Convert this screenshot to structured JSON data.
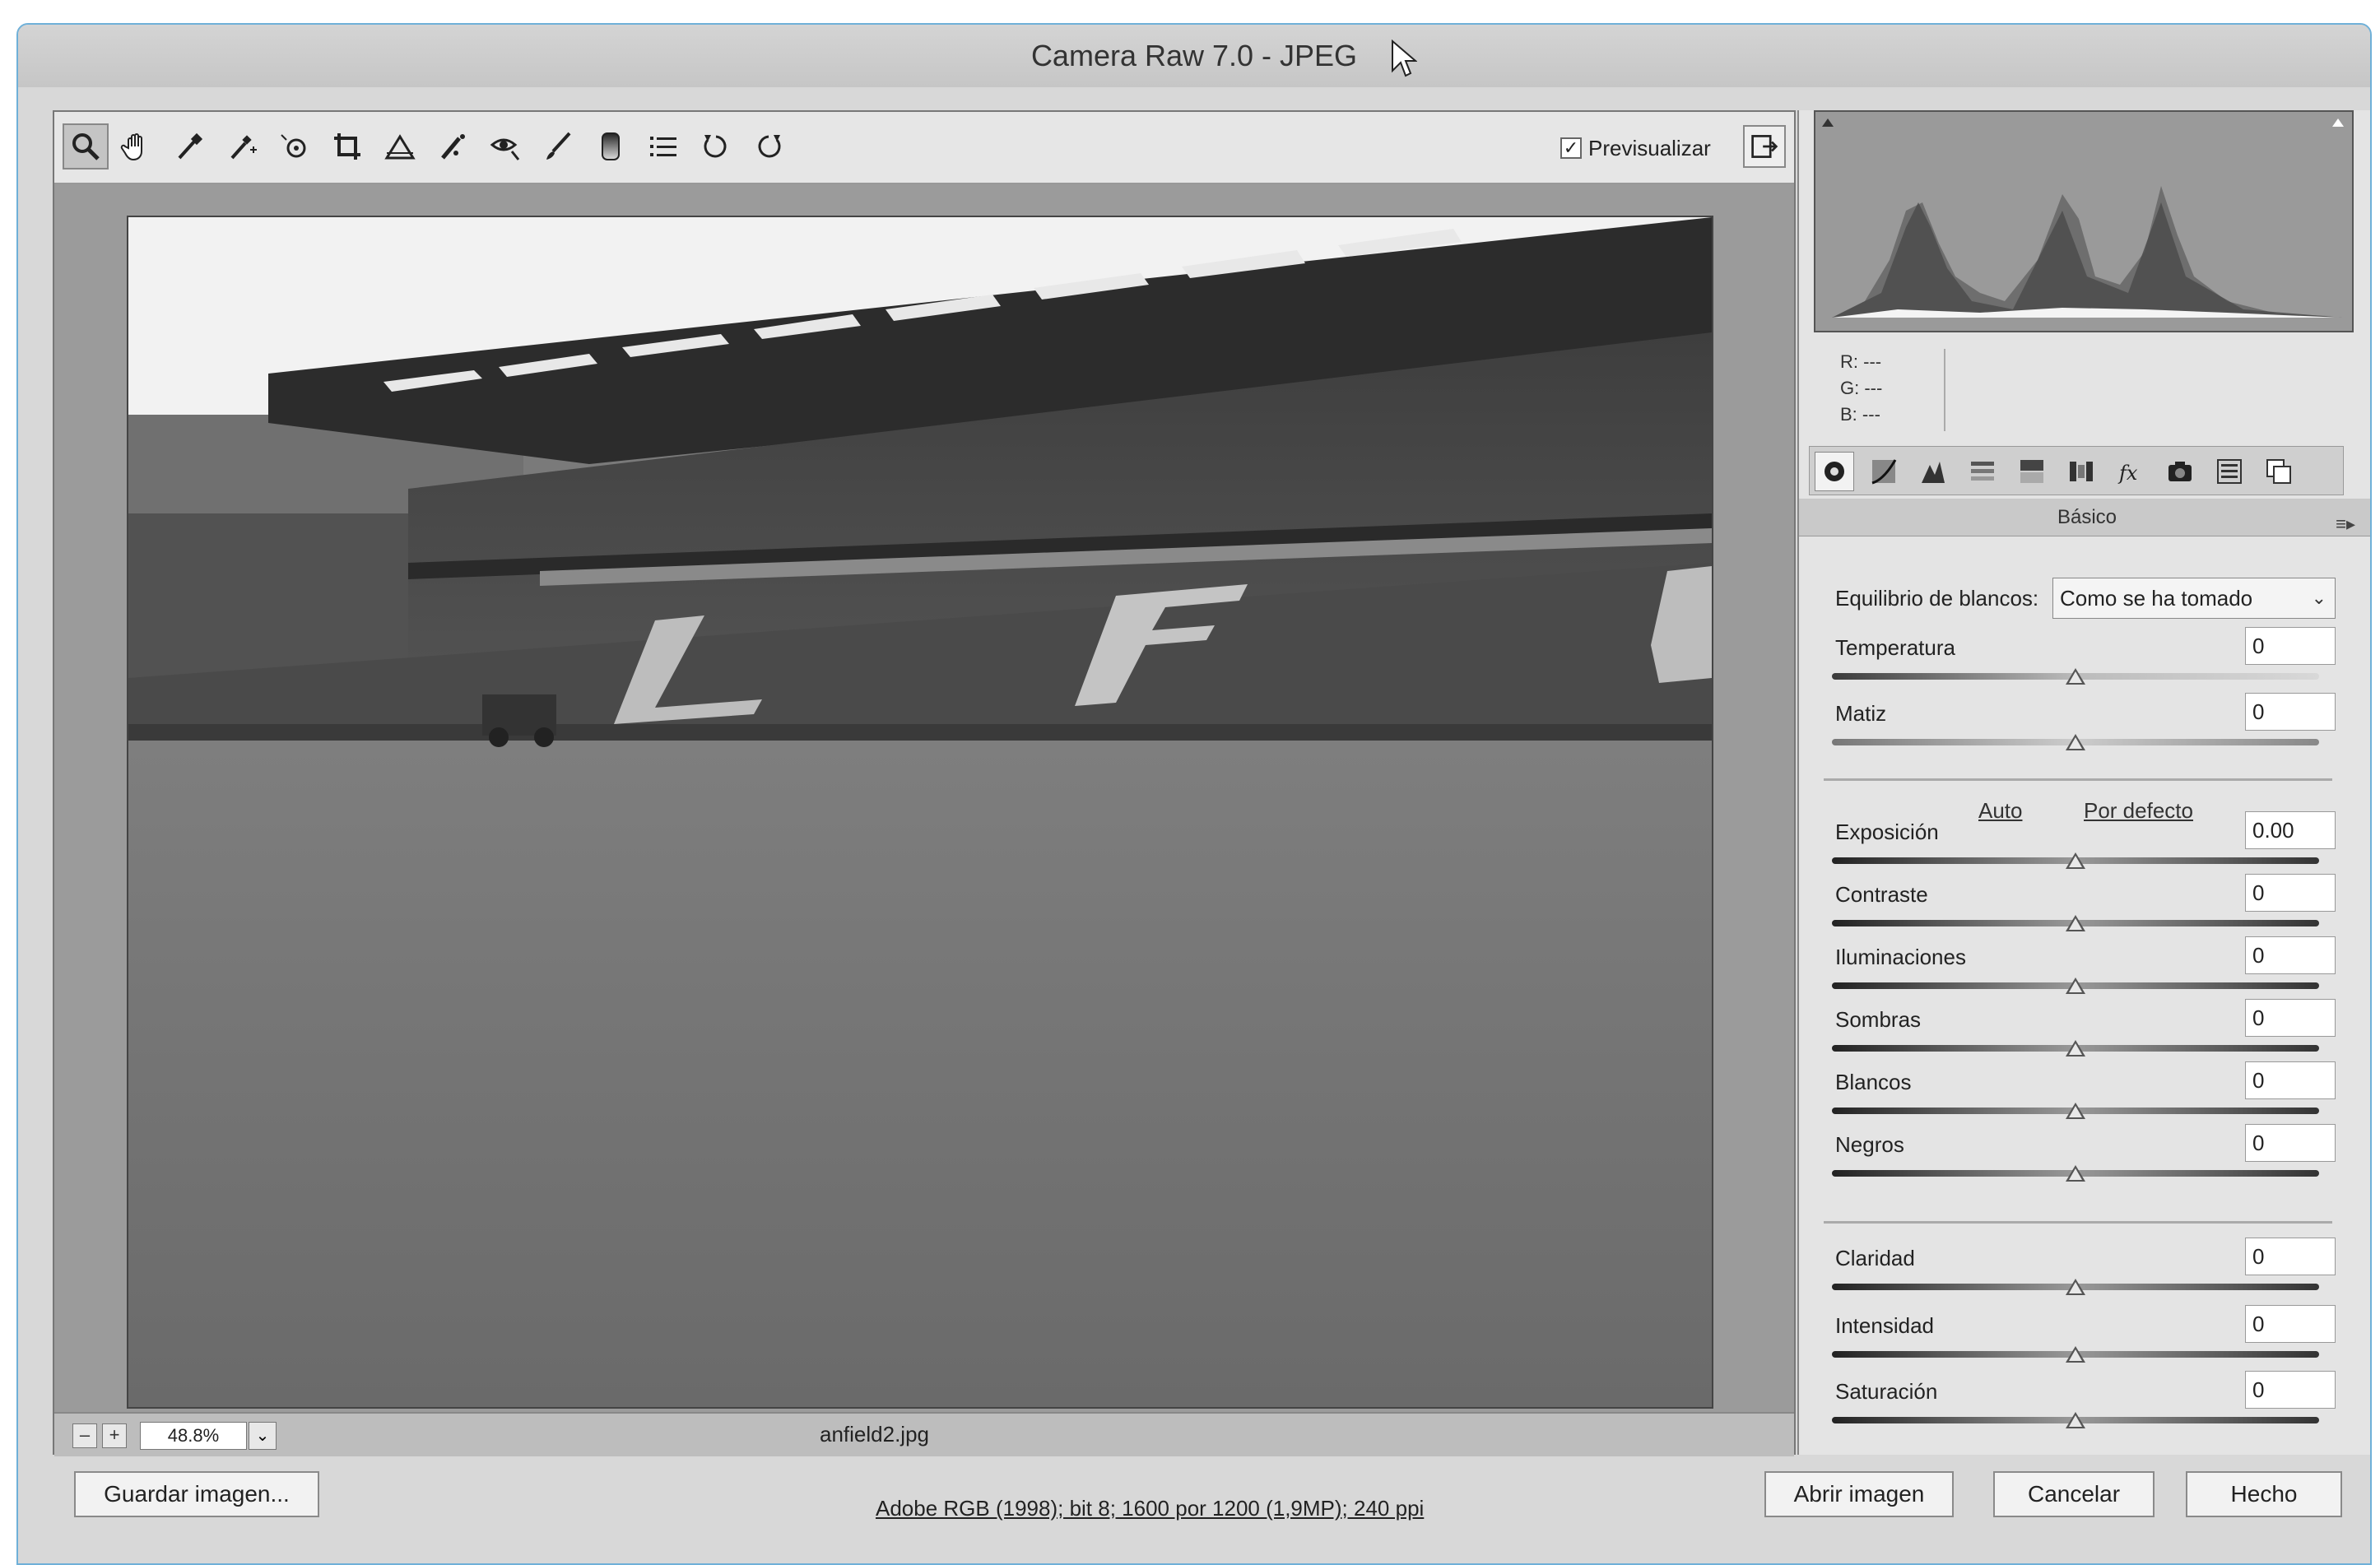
{
  "window": {
    "title": "Camera Raw 7.0 -  JPEG"
  },
  "toolbar": {
    "tools": [
      {
        "name": "zoom-tool",
        "icon": "magnifier-icon",
        "active": true
      },
      {
        "name": "hand-tool",
        "icon": "hand-icon"
      },
      {
        "name": "white-balance-tool",
        "icon": "eyedropper-icon"
      },
      {
        "name": "color-sampler-tool",
        "icon": "color-sampler-icon"
      },
      {
        "name": "targeted-adjustment-tool",
        "icon": "target-adjust-icon"
      },
      {
        "name": "crop-tool",
        "icon": "crop-icon"
      },
      {
        "name": "straighten-tool",
        "icon": "straighten-icon"
      },
      {
        "name": "spot-removal-tool",
        "icon": "spot-removal-icon"
      },
      {
        "name": "red-eye-tool",
        "icon": "red-eye-icon"
      },
      {
        "name": "adjustment-brush-tool",
        "icon": "brush-icon"
      },
      {
        "name": "graduated-filter-tool",
        "icon": "graduated-filter-icon"
      },
      {
        "name": "preferences-tool",
        "icon": "list-icon"
      },
      {
        "name": "rotate-left-tool",
        "icon": "rotate-ccw-icon"
      },
      {
        "name": "rotate-right-tool",
        "icon": "rotate-cw-icon"
      }
    ],
    "preview_label": "Previsualizar",
    "preview_checked": true
  },
  "status": {
    "zoom_value": "48.8%",
    "filename": "anfield2.jpg"
  },
  "histogram": {
    "r_label": "R:",
    "r_value": "---",
    "g_label": "G:",
    "g_value": "---",
    "b_label": "B:",
    "b_value": "---"
  },
  "panel": {
    "tabs": [
      "basic-icon",
      "tone-curve-icon",
      "detail-icon",
      "hsl-icon",
      "split-toning-icon",
      "lens-corrections-icon",
      "effects-icon",
      "camera-calibration-icon",
      "presets-icon",
      "snapshots-icon"
    ],
    "section_title": "Básico",
    "white_balance_label": "Equilibrio de blancos:",
    "white_balance_value": "Como se ha tomado",
    "auto_label": "Auto",
    "default_label": "Por defecto",
    "sliders": [
      {
        "key": "temperatura",
        "label": "Temperatura",
        "value": "0",
        "position": 0.5
      },
      {
        "key": "matiz",
        "label": "Matiz",
        "value": "0",
        "position": 0.5
      },
      {
        "key": "exposicion",
        "label": "Exposición",
        "value": "0.00",
        "position": 0.5
      },
      {
        "key": "contraste",
        "label": "Contraste",
        "value": "0",
        "position": 0.5
      },
      {
        "key": "iluminaciones",
        "label": "Iluminaciones",
        "value": "0",
        "position": 0.5
      },
      {
        "key": "sombras",
        "label": "Sombras",
        "value": "0",
        "position": 0.5
      },
      {
        "key": "blancos",
        "label": "Blancos",
        "value": "0",
        "position": 0.5
      },
      {
        "key": "negros",
        "label": "Negros",
        "value": "0",
        "position": 0.5
      },
      {
        "key": "claridad",
        "label": "Claridad",
        "value": "0",
        "position": 0.5
      },
      {
        "key": "intensidad",
        "label": "Intensidad",
        "value": "0",
        "position": 0.5
      },
      {
        "key": "saturacion",
        "label": "Saturación",
        "value": "0",
        "position": 0.5
      }
    ]
  },
  "footer": {
    "save_label": "Guardar imagen...",
    "info_link": "Adobe RGB (1998); bit 8; 1600 por 1200 (1,9MP); 240 ppi",
    "open_label": "Abrir imagen",
    "cancel_label": "Cancelar",
    "done_label": "Hecho"
  }
}
